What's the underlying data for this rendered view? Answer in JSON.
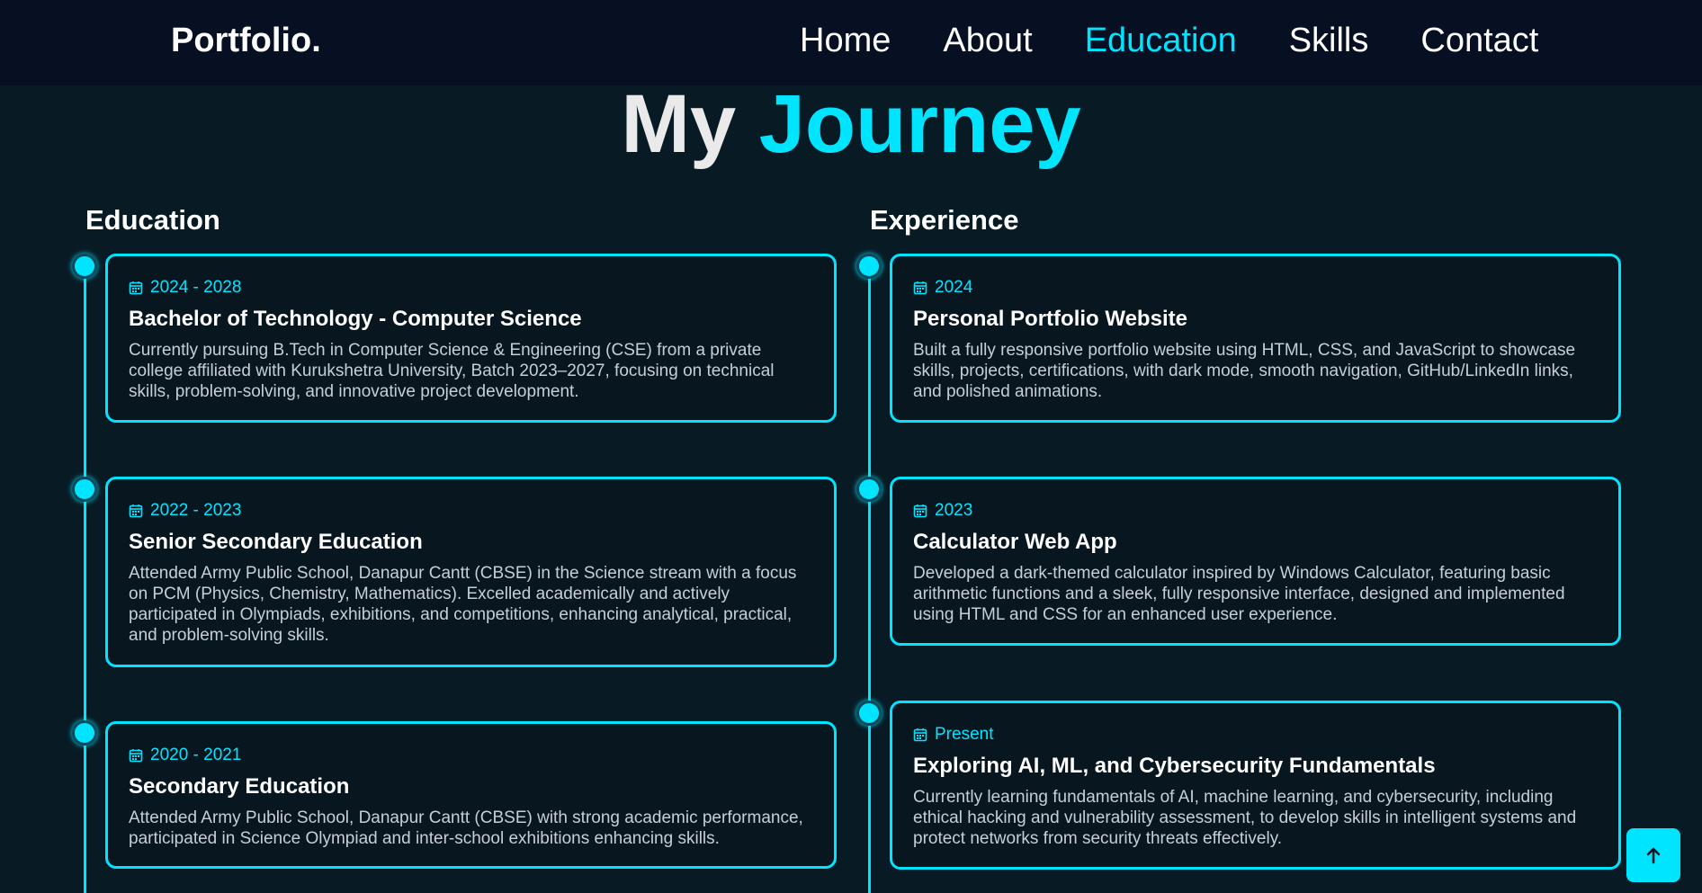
{
  "nav": {
    "logo": "Portfolio.",
    "links": [
      "Home",
      "About",
      "Education",
      "Skills",
      "Contact"
    ],
    "active": "Education"
  },
  "title": {
    "part1": "My",
    "part2": "Journey"
  },
  "education": {
    "heading": "Education",
    "items": [
      {
        "date": "2024 - 2028",
        "title": "Bachelor of Technology - Computer Science",
        "desc": "Currently pursuing B.Tech in Computer Science & Engineering (CSE) from a private college affiliated with Kurukshetra University, Batch 2023–2027, focusing on technical skills, problem-solving, and innovative project development."
      },
      {
        "date": "2022 - 2023",
        "title": "Senior Secondary Education",
        "desc": "Attended Army Public School, Danapur Cantt (CBSE) in the Science stream with a focus on PCM (Physics, Chemistry, Mathematics). Excelled academically and actively participated in Olympiads, exhibitions, and competitions, enhancing analytical, practical, and problem-solving skills."
      },
      {
        "date": "2020 - 2021",
        "title": "Secondary Education",
        "desc": "Attended Army Public School, Danapur Cantt (CBSE) with strong academic performance, participated in Science Olympiad and inter-school exhibitions enhancing skills."
      }
    ]
  },
  "experience": {
    "heading": "Experience",
    "items": [
      {
        "date": "2024",
        "title": "Personal Portfolio Website",
        "desc": "Built a fully responsive portfolio website using HTML, CSS, and JavaScript to showcase skills, projects, certifications, with dark mode, smooth navigation, GitHub/LinkedIn links, and polished animations."
      },
      {
        "date": "2023",
        "title": "Calculator Web App",
        "desc": "Developed a dark-themed calculator inspired by Windows Calculator, featuring basic arithmetic functions and a sleek, fully responsive interface, designed and implemented using HTML and CSS for an enhanced user experience."
      },
      {
        "date": "Present",
        "title": "Exploring AI, ML, and Cybersecurity Fundamentals",
        "desc": "Currently learning fundamentals of AI, machine learning, and cybersecurity, including ethical hacking and vulnerability assessment, to develop skills in intelligent systems and protect networks from security threats effectively."
      }
    ]
  },
  "icons": {
    "date": "calendar-icon",
    "scroll_top": "arrow-up-icon"
  },
  "colors": {
    "accent": "#00e5ff",
    "background": "#081b25",
    "navbar": "#070f23"
  }
}
